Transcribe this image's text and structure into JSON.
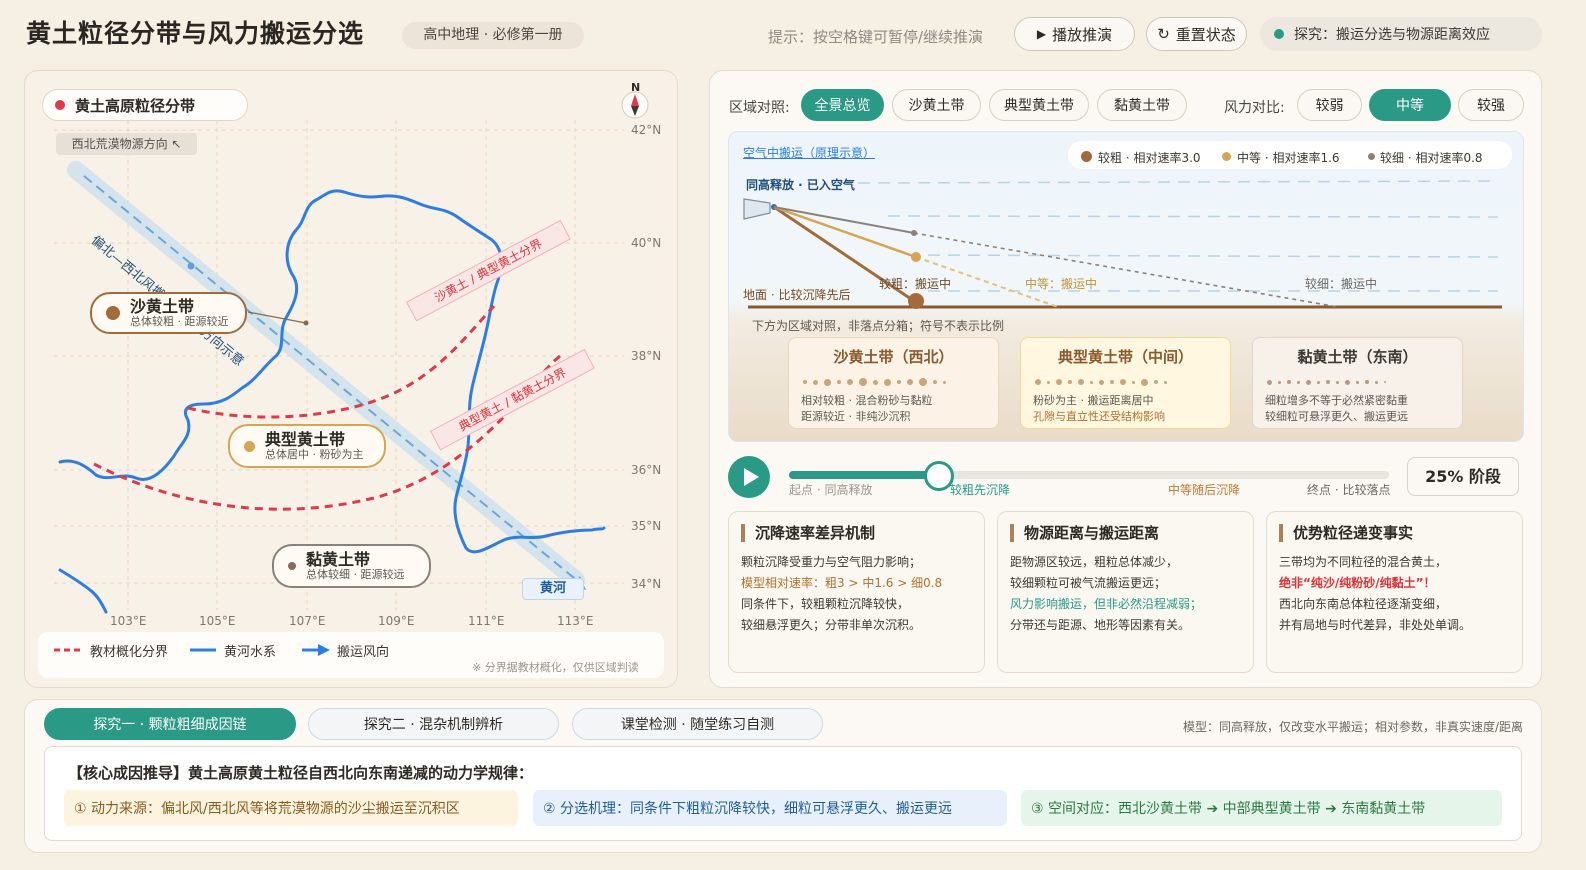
{
  "header": {
    "title": "黄土粒径分带与风力搬运分选",
    "grade_badge": "高中地理 · 必修第一册",
    "hint": "提示：按空格键可暂停/继续推演",
    "play_label": "播放推演",
    "reset_label": "重置状态",
    "explore_label": "探究：搬运分选与物源距离效应"
  },
  "map": {
    "title": "黄土高原粒径分带",
    "source_direction": "西北荒漠物源方向 ↖",
    "north": "N",
    "wind_label": "偏北—西北风搬运 · 总体方向示意",
    "boundary_1": "沙黄土 / 典型黄土分界",
    "boundary_2": "典型黄土 / 黏黄土分界",
    "river_label": "黄河",
    "zones": [
      {
        "name": "沙黄土带",
        "desc": "总体较粗 · 距源较近"
      },
      {
        "name": "典型黄土带",
        "desc": "总体居中 · 粉砂为主"
      },
      {
        "name": "黏黄土带",
        "desc": "总体较细 · 距源较远"
      }
    ],
    "lat_labels": [
      "42°N",
      "40°N",
      "38°N",
      "36°N",
      "35°N",
      "34°N"
    ],
    "lon_labels": [
      "103°E",
      "105°E",
      "107°E",
      "109°E",
      "111°E",
      "113°E"
    ],
    "legend": {
      "boundary": "教材概化分界",
      "river": "黄河水系",
      "wind": "搬运风向",
      "note": "※ 分界据教材概化，仅供区域判读"
    }
  },
  "controls": {
    "region_label": "区域对照:",
    "regions": [
      "全景总览",
      "沙黄土带",
      "典型黄土带",
      "黏黄土带"
    ],
    "region_active": "全景总览",
    "wind_label": "风力对比:",
    "winds": [
      "较弱",
      "中等",
      "较强"
    ],
    "wind_active": "中等"
  },
  "simulation": {
    "title": "空气中搬运（原理示意）",
    "release_label": "同高释放 · 已入空气",
    "ground_label": "地面 · 比较沉降先后",
    "zone_note": "下方为区域对照，非落点分箱；符号不表示比例",
    "legend": [
      {
        "label": "较粗 · 相对速率3.0",
        "color": "#a36b3b"
      },
      {
        "label": "中等 · 相对速率1.6",
        "color": "#d6a553"
      },
      {
        "label": "较细 · 相对速率0.8",
        "color": "#8a8178"
      }
    ],
    "status": {
      "coarse": "较粗：搬运中",
      "medium": "中等：搬运中",
      "fine": "较细：搬运中"
    },
    "zone_cards": [
      {
        "title": "沙黄土带（西北）",
        "line1": "相对较粗 · 混合粉砂与黏粒",
        "line2": "距源较近 · 非纯沙沉积"
      },
      {
        "title": "典型黄土带（中间）",
        "line1": "粉砂为主 · 搬运距离居中",
        "line2": "孔隙与直立性还受结构影响"
      },
      {
        "title": "黏黄土带（东南）",
        "line1": "细粒增多不等于必然紧密黏重",
        "line2": "较细粒可悬浮更久、搬运更远"
      }
    ]
  },
  "timeline": {
    "progress": 0.25,
    "stage": "25% 阶段",
    "ticks": [
      "起点 · 同高释放",
      "较粗先沉降",
      "中等随后沉降",
      "终点 · 比较落点"
    ]
  },
  "cards": [
    {
      "title": "沉降速率差异机制",
      "l1": "颗粒沉降受重力与空气阻力影响；",
      "l2": "模型相对速率：粗3 > 中1.6 > 细0.8",
      "l3": "同条件下，较粗颗粒沉降较快，",
      "l4": "较细悬浮更久；分带非单次沉积。"
    },
    {
      "title": "物源距离与搬运距离",
      "l1": "距物源区较远，粗粒总体减少，",
      "l2": "较细颗粒可被气流搬运更远；",
      "l3": "风力影响搬运，但非必然沿程减弱；",
      "l4": "分带还与距源、地形等因素有关。"
    },
    {
      "title": "优势粒径递变事实",
      "l1": "三带均为不同粒径的混合黄土，",
      "l2": "绝非“纯沙/纯粉砂/纯黏土”！",
      "l3": "西北向东南总体粒径逐渐变细，",
      "l4": "并有局地与时代差异，非处处单调。"
    }
  ],
  "bottom": {
    "tabs": [
      "探究一 · 颗粒粗细成因链",
      "探究二 · 混杂机制辨析",
      "课堂检测 · 随堂练习自测"
    ],
    "tab_active": 0,
    "model_note": "模型：同高释放，仅改变水平搬运；相对参数，非真实速度/距离",
    "core_title": "【核心成因推导】黄土高原黄土粒径自西北向东南递减的动力学规律：",
    "steps": [
      "① 动力来源：偏北风/西北风等将荒漠物源的沙尘搬运至沉积区",
      "② 分选机理：同条件下粗粒沉降较快，细粒可悬浮更久、搬运更远",
      "③ 空间对应：西北沙黄土带 ➔ 中部典型黄土带 ➔ 东南黏黄土带"
    ]
  },
  "colors": {
    "accent": "#2a9a86",
    "boundary": "#e0394a",
    "river": "#2f7de0",
    "coarse": "#a36b3b",
    "medium": "#d6a553",
    "fine": "#8a8178"
  }
}
